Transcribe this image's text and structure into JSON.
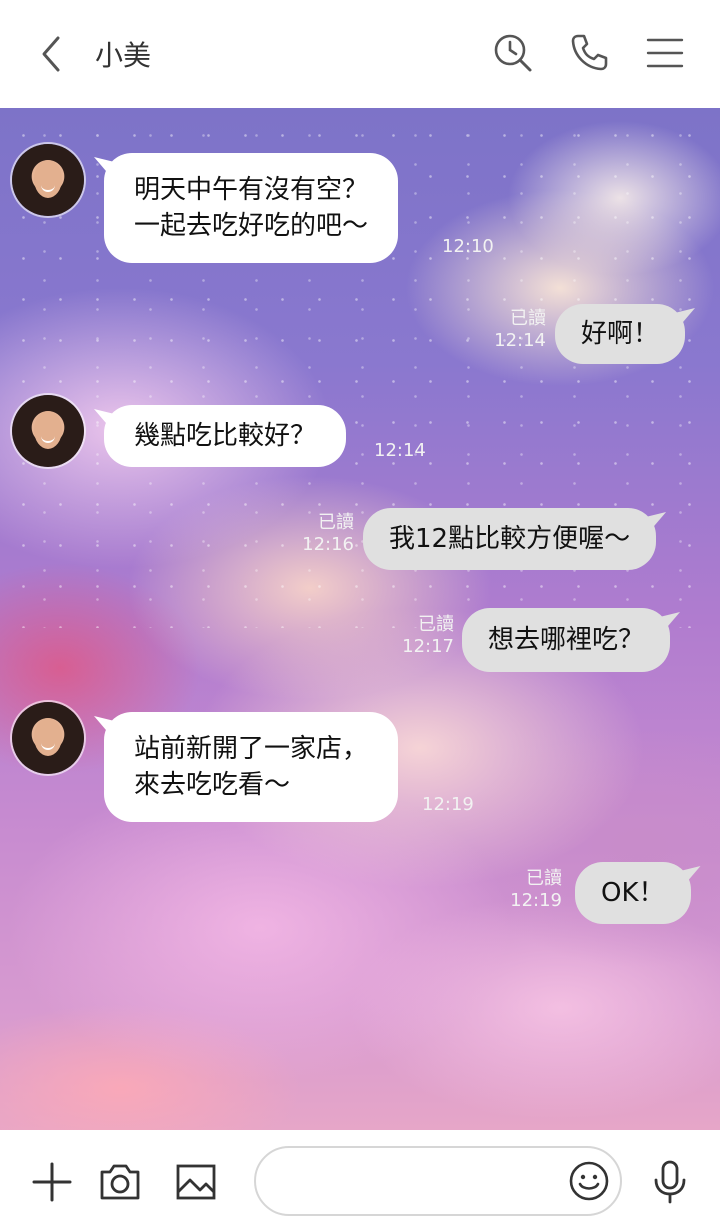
{
  "header": {
    "back_icon": "chevron-left-icon",
    "title": "小美",
    "search_icon": "clock-search-icon",
    "call_icon": "phone-icon",
    "menu_icon": "hamburger-menu-icon"
  },
  "chat": {
    "messages": [
      {
        "side": "in",
        "lines": [
          "明天中午有沒有空？",
          "一起去吃好吃的吧～"
        ],
        "time": "12:10"
      },
      {
        "side": "out",
        "lines": [
          "好啊！"
        ],
        "read": "已讀",
        "time": "12:14"
      },
      {
        "side": "in",
        "lines": [
          "幾點吃比較好？"
        ],
        "time": "12:14"
      },
      {
        "side": "out",
        "lines": [
          "我12點比較方便喔～"
        ],
        "read": "已讀",
        "time": "12:16"
      },
      {
        "side": "out",
        "lines": [
          "想去哪裡吃？"
        ],
        "read": "已讀",
        "time": "12:17"
      },
      {
        "side": "in",
        "lines": [
          "站前新開了一家店，",
          "來去吃吃看～"
        ],
        "time": "12:19"
      },
      {
        "side": "out",
        "lines": [
          "OK！"
        ],
        "read": "已讀",
        "time": "12:19"
      }
    ]
  },
  "inputbar": {
    "plus_icon": "plus-icon",
    "camera_icon": "camera-icon",
    "image_icon": "image-icon",
    "placeholder": "",
    "emoji_icon": "emoji-icon",
    "mic_icon": "microphone-icon"
  },
  "colors": {
    "incoming_bubble": "#ffffff",
    "outgoing_bubble": "#e0e0e0",
    "timestamp": "#f2f2f2"
  }
}
